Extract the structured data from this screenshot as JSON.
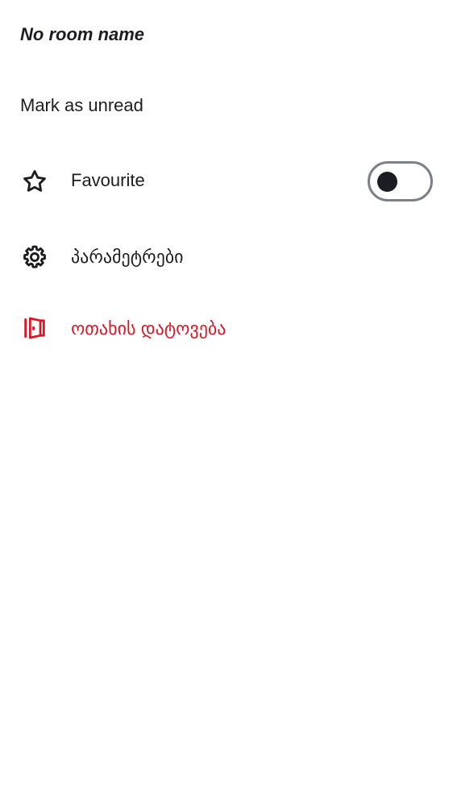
{
  "room": {
    "title": "No room name"
  },
  "menu": {
    "mark_unread_label": "Mark as unread",
    "favourite_label": "Favourite",
    "favourite_enabled": false,
    "settings_label": "პარამეტრები",
    "leave_label": "ოთახის დატოვება"
  },
  "icons": {
    "favourite": "star-icon",
    "settings": "gear-icon",
    "leave": "door-exit-icon"
  },
  "colors": {
    "text_primary": "#1b1d22",
    "danger": "#d51928",
    "toggle_border": "#7b8089",
    "background": "#ffffff"
  }
}
